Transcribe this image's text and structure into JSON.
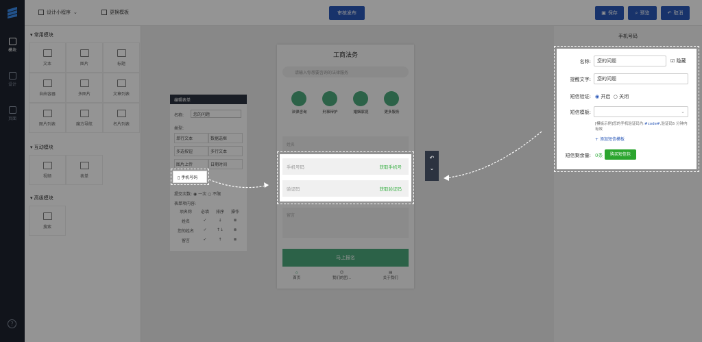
{
  "topbar": {
    "design": "设计小程序",
    "template": "更换模板",
    "publish": "审核发布",
    "save": "保存",
    "preview": "预览",
    "cancel": "取消"
  },
  "rail": {
    "module": "模块",
    "r2": "设计",
    "r3": "页面"
  },
  "left": {
    "common": {
      "title": "常用模块",
      "items": [
        "文本",
        "图片",
        "标题",
        "自由容器",
        "多图片",
        "文章列表",
        "图片列表",
        "魔方导航",
        "名片列表"
      ]
    },
    "interactive": {
      "title": "互动模块",
      "items": [
        "视频",
        "表单"
      ]
    },
    "advanced": {
      "title": "高级模块",
      "items": [
        "搜索"
      ]
    }
  },
  "form_panel": {
    "title": "编辑表单",
    "name_label": "名称:",
    "name_value": "您的问题",
    "type_label": "类型:",
    "types": [
      "单行文本",
      "数据选框",
      "多选按钮",
      "多行文本",
      "图片上传",
      "日期时间"
    ],
    "phone": "手机号码",
    "submit_label": "提交次数:",
    "once": "一次",
    "unlimited": "不限",
    "items_label": "表单项内容:",
    "headers": [
      "项名称",
      "必填",
      "排序",
      "操作"
    ],
    "rows": [
      "姓名",
      "您的姓名",
      "留言"
    ]
  },
  "phone": {
    "title": "工商法务",
    "search_placeholder": "请输入你想要咨询的法律服务",
    "icons": [
      "法律咨询",
      "刑事辩护",
      "婚姻家庭",
      "更多服务"
    ],
    "name_ph": "姓名",
    "phone_ph": "手机号码",
    "phone_btn": "获取手机号",
    "code_ph": "验证码",
    "code_btn": "获取验证码",
    "msg_ph": "留言",
    "submit": "马上报名",
    "tabs": [
      "首页",
      "我们的团...",
      "关于我们"
    ]
  },
  "right": {
    "title": "手机号码",
    "name_label": "名称:",
    "name_value": "您的问题",
    "hide": "隐藏",
    "hint_label": "提醒文字:",
    "hint_value": "您的问题",
    "sms_label": "短信验证:",
    "on": "开启",
    "off": "关闭",
    "tpl_label": "短信模板:",
    "tpl_text": "[模板示例]您的手机验证码为:",
    "tpl_code": "#code#",
    "tpl_text2": ",验证码5 分钟内有效",
    "add_tpl": "添加短信模板",
    "balance_label": "短信剩余量:",
    "balance_value": "0条",
    "buy": "购买短信包"
  },
  "colors": {
    "accent": "#2a58b8",
    "green": "#3fb24a",
    "teal": "#4caa7c"
  }
}
